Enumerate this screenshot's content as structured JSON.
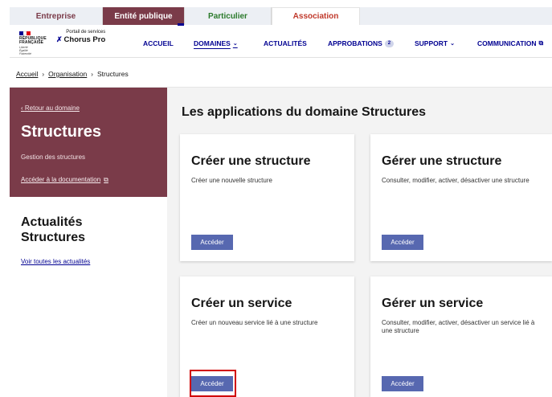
{
  "audience_tabs": [
    "Entreprise",
    "Entité publique",
    "Particulier",
    "Association"
  ],
  "logo": {
    "republique": [
      "RÉPUBLIQUE",
      "FRANÇAISE"
    ],
    "devise": [
      "Liberté",
      "Égalité",
      "Fraternité"
    ],
    "brand_sub": "Portail de services",
    "brand_name": "Chorus Pro"
  },
  "nav": {
    "accueil": "ACCUEIL",
    "domaines": "DOMAINES",
    "actualites": "ACTUALITÉS",
    "approbations": "APPROBATIONS",
    "approbations_count": "2",
    "support": "SUPPORT",
    "communication": "COMMUNICATION"
  },
  "breadcrumb": [
    "Accueil",
    "Organisation",
    "Structures"
  ],
  "sidebar": {
    "back_link": "Retour au domaine",
    "title": "Structures",
    "description": "Gestion des structures",
    "doc_link": "Accéder à la documentation",
    "news_title": "Actualités Structures",
    "news_link": "Voir toutes les actualités"
  },
  "main": {
    "title": "Les applications du domaine Structures",
    "button_label": "Accéder",
    "cards": [
      {
        "title": "Créer une structure",
        "desc": "Créer une nouvelle structure"
      },
      {
        "title": "Gérer une structure",
        "desc": "Consulter, modifier, activer, désactiver une structure"
      },
      {
        "title": "Créer un service",
        "desc": "Créer un nouveau service lié à une structure"
      },
      {
        "title": "Gérer un service",
        "desc": "Consulter, modifier, activer, désactiver un service lié à une structure"
      }
    ]
  },
  "colors": {
    "primary": "#000091",
    "sidebar": "#7a3b49",
    "button": "#5768b0",
    "highlight": "#d10000"
  }
}
